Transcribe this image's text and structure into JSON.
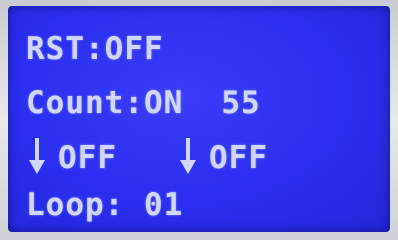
{
  "display": {
    "row1": {
      "label": "RST:",
      "value": "OFF"
    },
    "row2": {
      "label": "Count:",
      "value": "ON",
      "number": "55"
    },
    "row3": {
      "left": {
        "icon": "down-arrow-icon",
        "value": "OFF"
      },
      "right": {
        "icon": "down-arrow-icon",
        "value": "OFF"
      }
    },
    "row4": {
      "label": "Loop:",
      "value": "01"
    }
  },
  "colors": {
    "background": "#2b2ef0",
    "text": "#cfd6ff"
  }
}
